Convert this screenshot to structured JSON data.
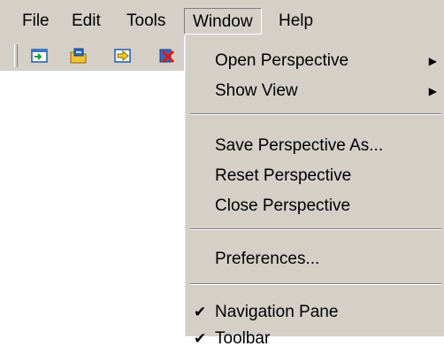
{
  "menubar": {
    "items": [
      {
        "label": "File"
      },
      {
        "label": "Edit"
      },
      {
        "label": "Tools"
      },
      {
        "label": "Window"
      },
      {
        "label": "Help"
      }
    ]
  },
  "toolbar": {
    "icons": [
      "navigate-in-icon",
      "folder-open-icon",
      "forward-arrow-icon",
      "delete-icon"
    ]
  },
  "window_menu": {
    "items": [
      {
        "label": "Open Perspective",
        "arrow": "▶"
      },
      {
        "label": "Show View",
        "arrow": "▶"
      },
      {
        "label": "Save Perspective As..."
      },
      {
        "label": "Reset Perspective"
      },
      {
        "label": "Close Perspective"
      },
      {
        "label": "Preferences..."
      },
      {
        "label": "Navigation Pane",
        "check": "✔"
      },
      {
        "label": "Toolbar",
        "check": "✔"
      }
    ]
  },
  "colors": {
    "chrome": "#d4d0c8",
    "shadow": "#808080",
    "highlight": "#ffffff"
  }
}
